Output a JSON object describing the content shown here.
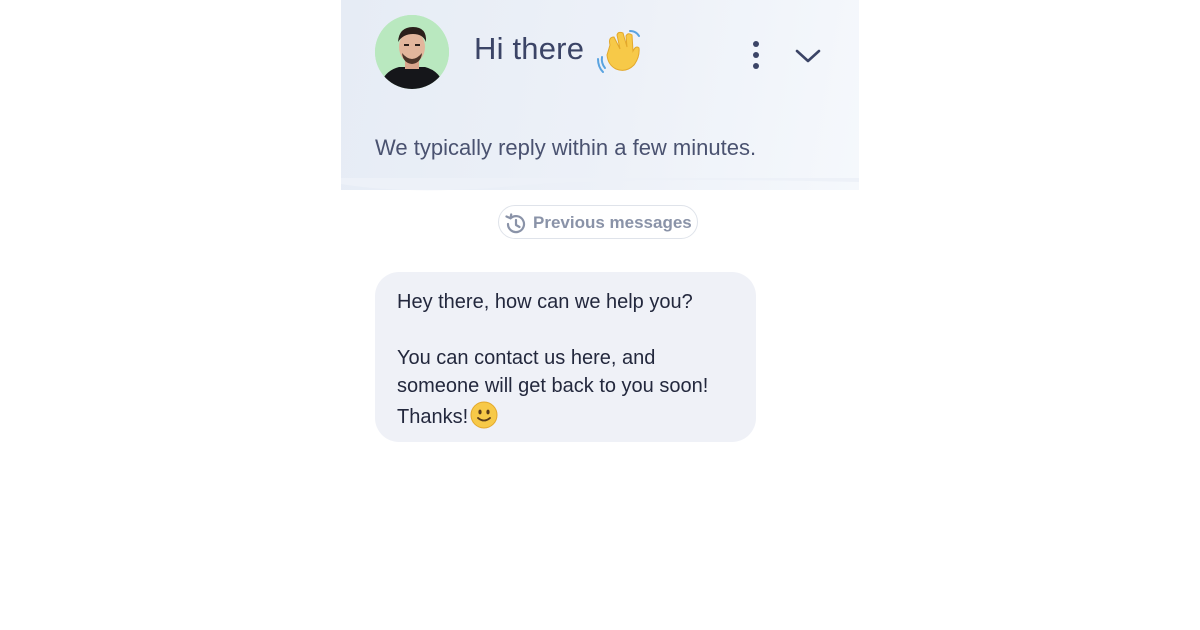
{
  "header": {
    "title": "Hi there",
    "subtitle": "We typically reply within a few minutes."
  },
  "icons": {
    "avatar": "agent-avatar",
    "wave": "waving-hand-icon",
    "menu": "kebab-menu-icon",
    "collapse": "chevron-down-icon",
    "history": "history-icon",
    "smile": "smiling-face-emoji"
  },
  "previous_messages": {
    "label": "Previous messages"
  },
  "message": {
    "line1": "Hey there, how can we help you?",
    "line2": "You can contact us here, and",
    "line3": "someone will get back to you soon!",
    "line4": "Thanks!"
  },
  "colors": {
    "header_bg": "#e8edf6",
    "text_dark": "#3b4466",
    "bubble_bg": "#eff1f7",
    "avatar_bg": "#b9e8bf"
  }
}
